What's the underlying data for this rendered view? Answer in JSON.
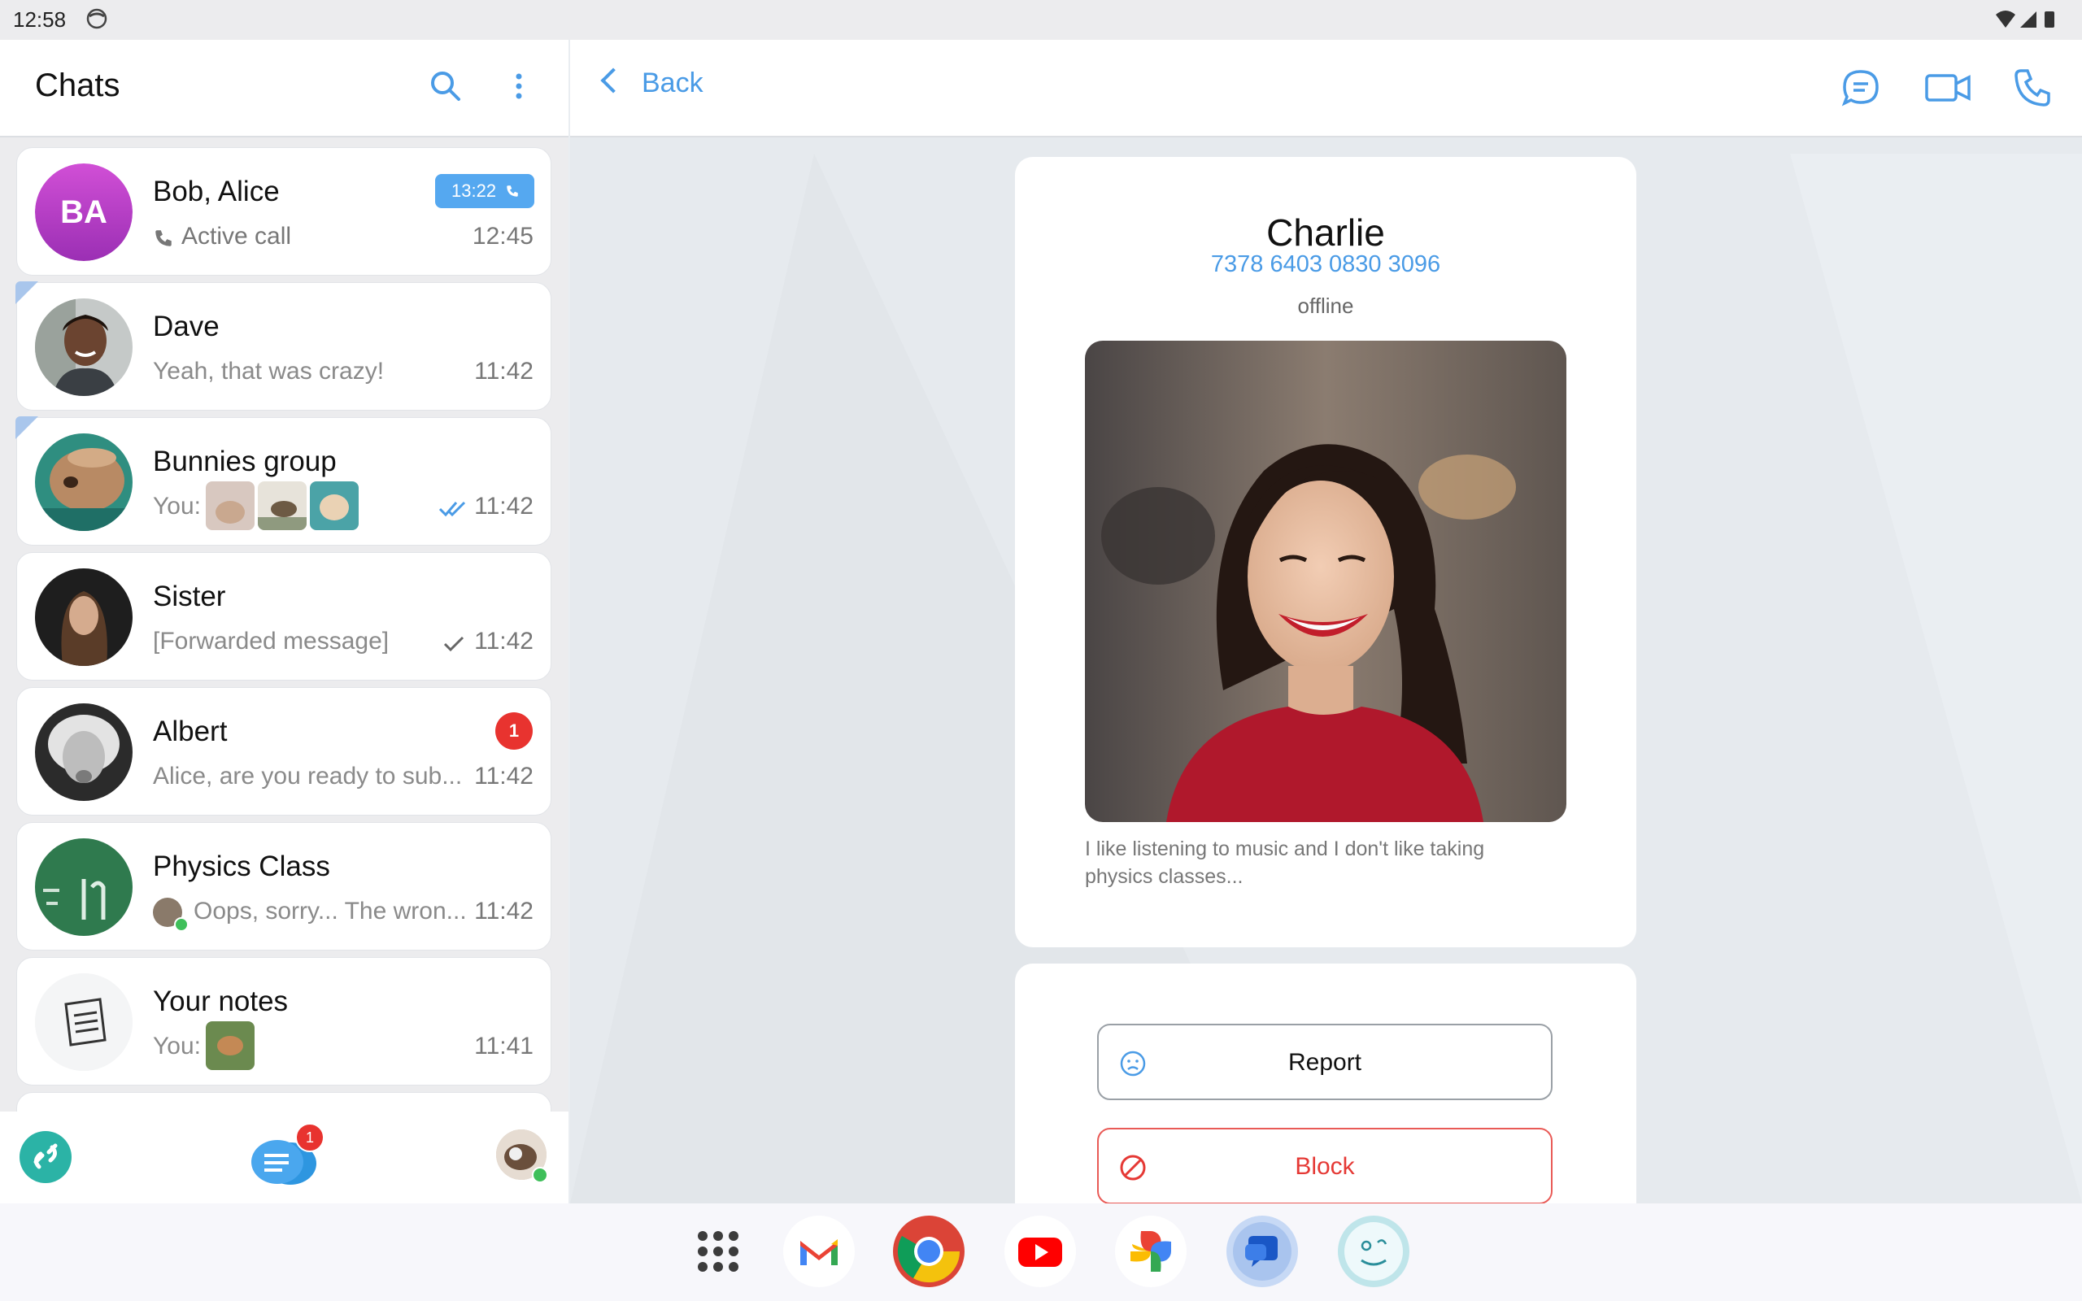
{
  "status_bar": {
    "time": "12:58"
  },
  "left_panel": {
    "title": "Chats",
    "chats": [
      {
        "name": "Bob, Alice",
        "preview": "Active call",
        "time": "12:45",
        "call_badge": "13:22",
        "avatar_initials": "BA"
      },
      {
        "name": "Dave",
        "preview": "Yeah, that was crazy!",
        "time": "11:42"
      },
      {
        "name": "Bunnies group",
        "preview": "You:",
        "time": "11:42",
        "read_status": "double-check"
      },
      {
        "name": "Sister",
        "preview": "[Forwarded message]",
        "time": "11:42",
        "read_status": "single-check"
      },
      {
        "name": "Albert",
        "preview": "Alice, are you ready to sub...",
        "time": "11:42",
        "unread_count": "1"
      },
      {
        "name": "Physics Class",
        "preview": "Oops, sorry... The wron...",
        "time": "11:42"
      },
      {
        "name": "Your notes",
        "preview": "You:",
        "time": "11:41"
      }
    ],
    "bottom_bar": {
      "chats_badge": "1"
    }
  },
  "right_panel": {
    "back_label": "Back",
    "contact": {
      "name": "Charlie",
      "phone": "7378 6403 0830 3096",
      "status": "offline",
      "bio": "I like listening to music and I don't like taking physics classes..."
    },
    "actions": {
      "report_label": "Report",
      "block_label": "Block"
    }
  },
  "colors": {
    "accent": "#4a9be6",
    "danger": "#e53935",
    "badge": "#55a8f0"
  }
}
